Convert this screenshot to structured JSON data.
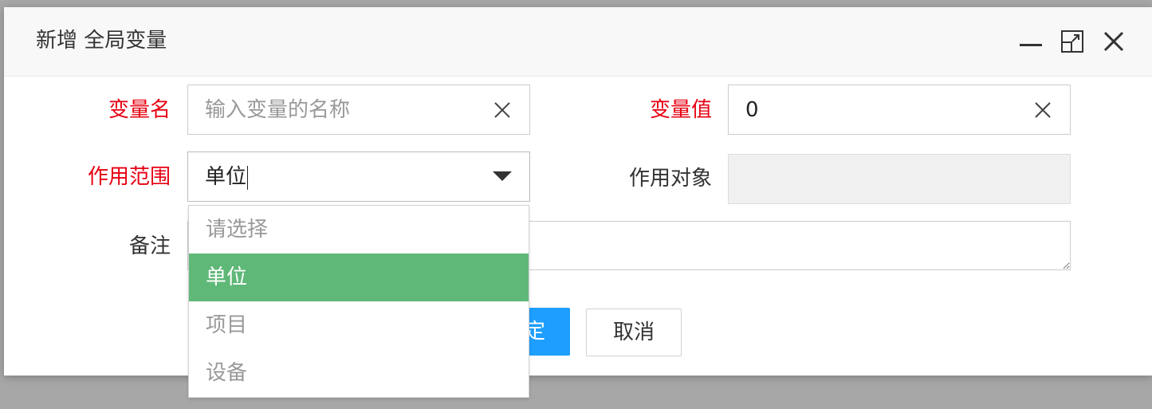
{
  "dialog": {
    "title": "新增 全局变量",
    "controls": [
      "minimize-icon",
      "maximize-icon",
      "close-icon"
    ]
  },
  "form": {
    "var_name": {
      "label": "变量名",
      "placeholder": "输入变量的名称",
      "value": "",
      "required": true
    },
    "var_value": {
      "label": "变量值",
      "value": "0",
      "required": true
    },
    "scope": {
      "label": "作用范围",
      "selected": "单位",
      "required": true
    },
    "target": {
      "label": "作用对象",
      "value": ""
    },
    "remarks": {
      "label": "备注",
      "value": ""
    }
  },
  "buttons": {
    "confirm": "定",
    "cancel": "取消"
  },
  "scope_dropdown": {
    "options": [
      "请选择",
      "单位",
      "项目",
      "设备"
    ],
    "selected_index": 1
  },
  "colors": {
    "required_label": "#e60012",
    "primary_button": "#1e9fff",
    "selected_option": "#5fb878"
  }
}
